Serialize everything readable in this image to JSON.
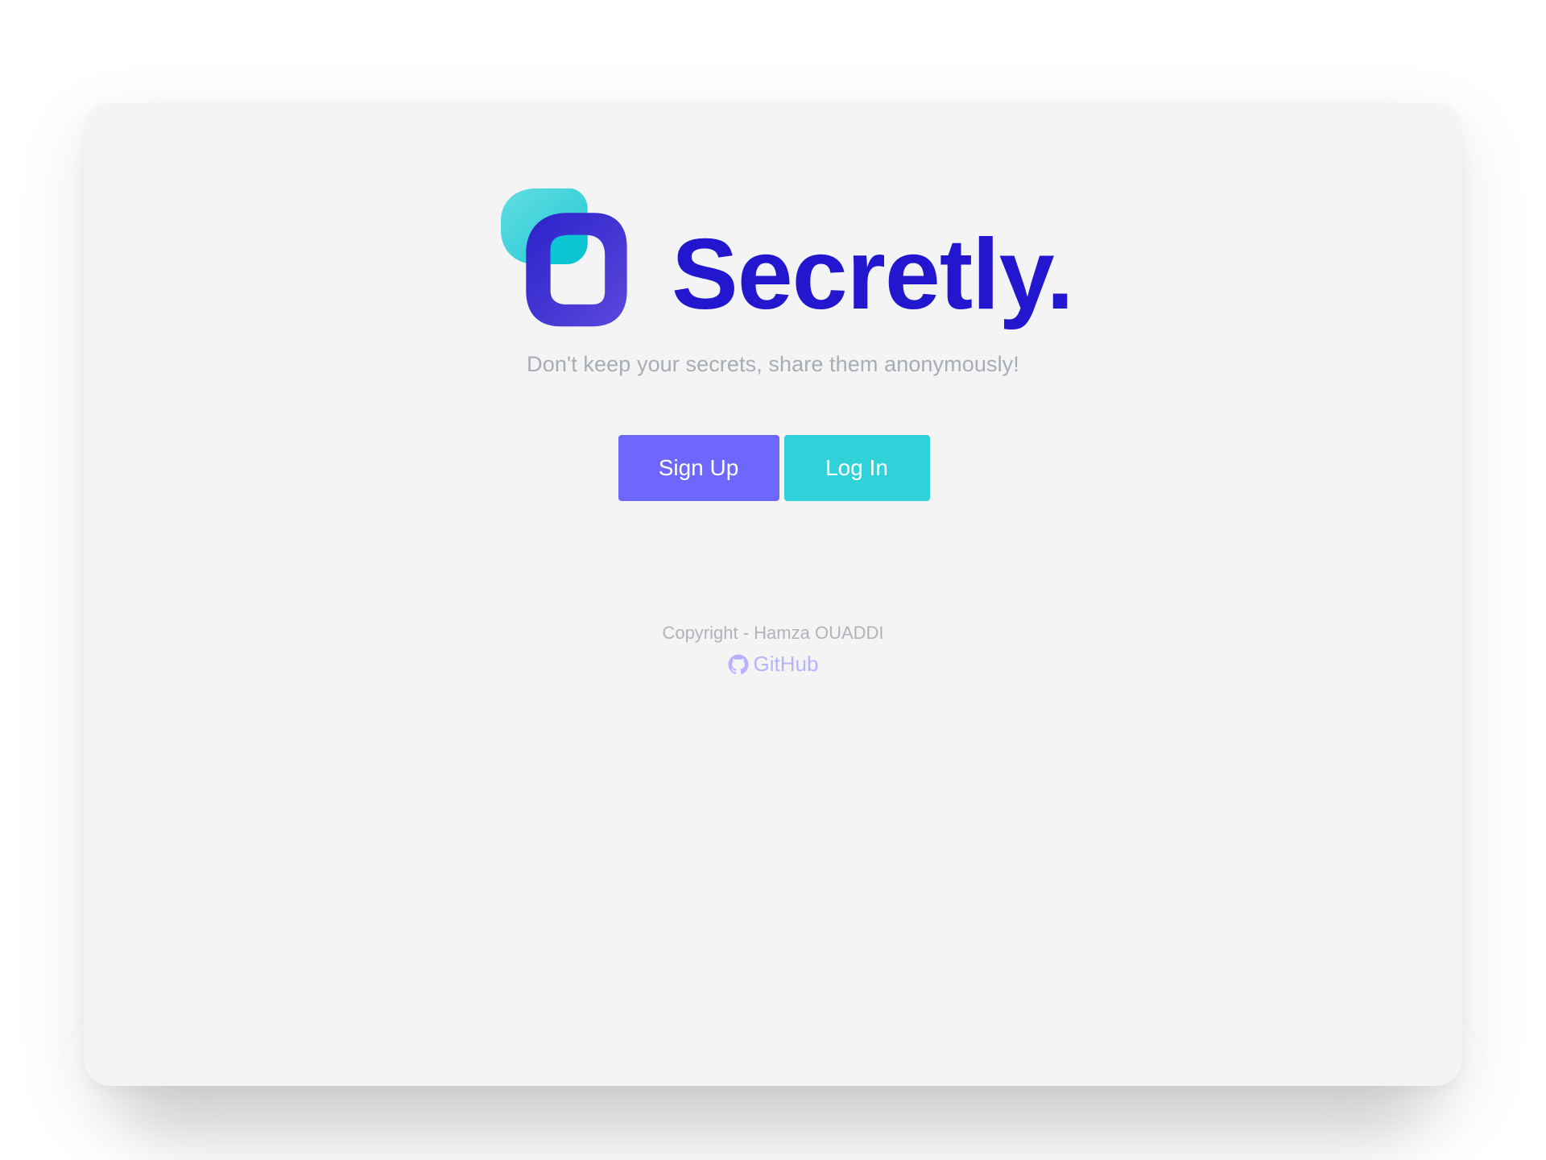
{
  "app": {
    "brand_name": "Secretly.",
    "tagline": "Don't keep your secrets, share them anonymously!"
  },
  "actions": {
    "signup_label": "Sign Up",
    "login_label": "Log In"
  },
  "footer": {
    "copyright": "Copyright - Hamza OUADDI",
    "github_label": "GitHub"
  },
  "icons": {
    "logo": "secretly-logo-mark",
    "github": "github-icon"
  },
  "colors": {
    "brand_text": "#2216cf",
    "signup_button": "#6e67fb",
    "login_button": "#31d1da",
    "card_background": "#f4f4f5",
    "muted_text": "#a7adb4",
    "github_link": "#b7b2ff"
  }
}
